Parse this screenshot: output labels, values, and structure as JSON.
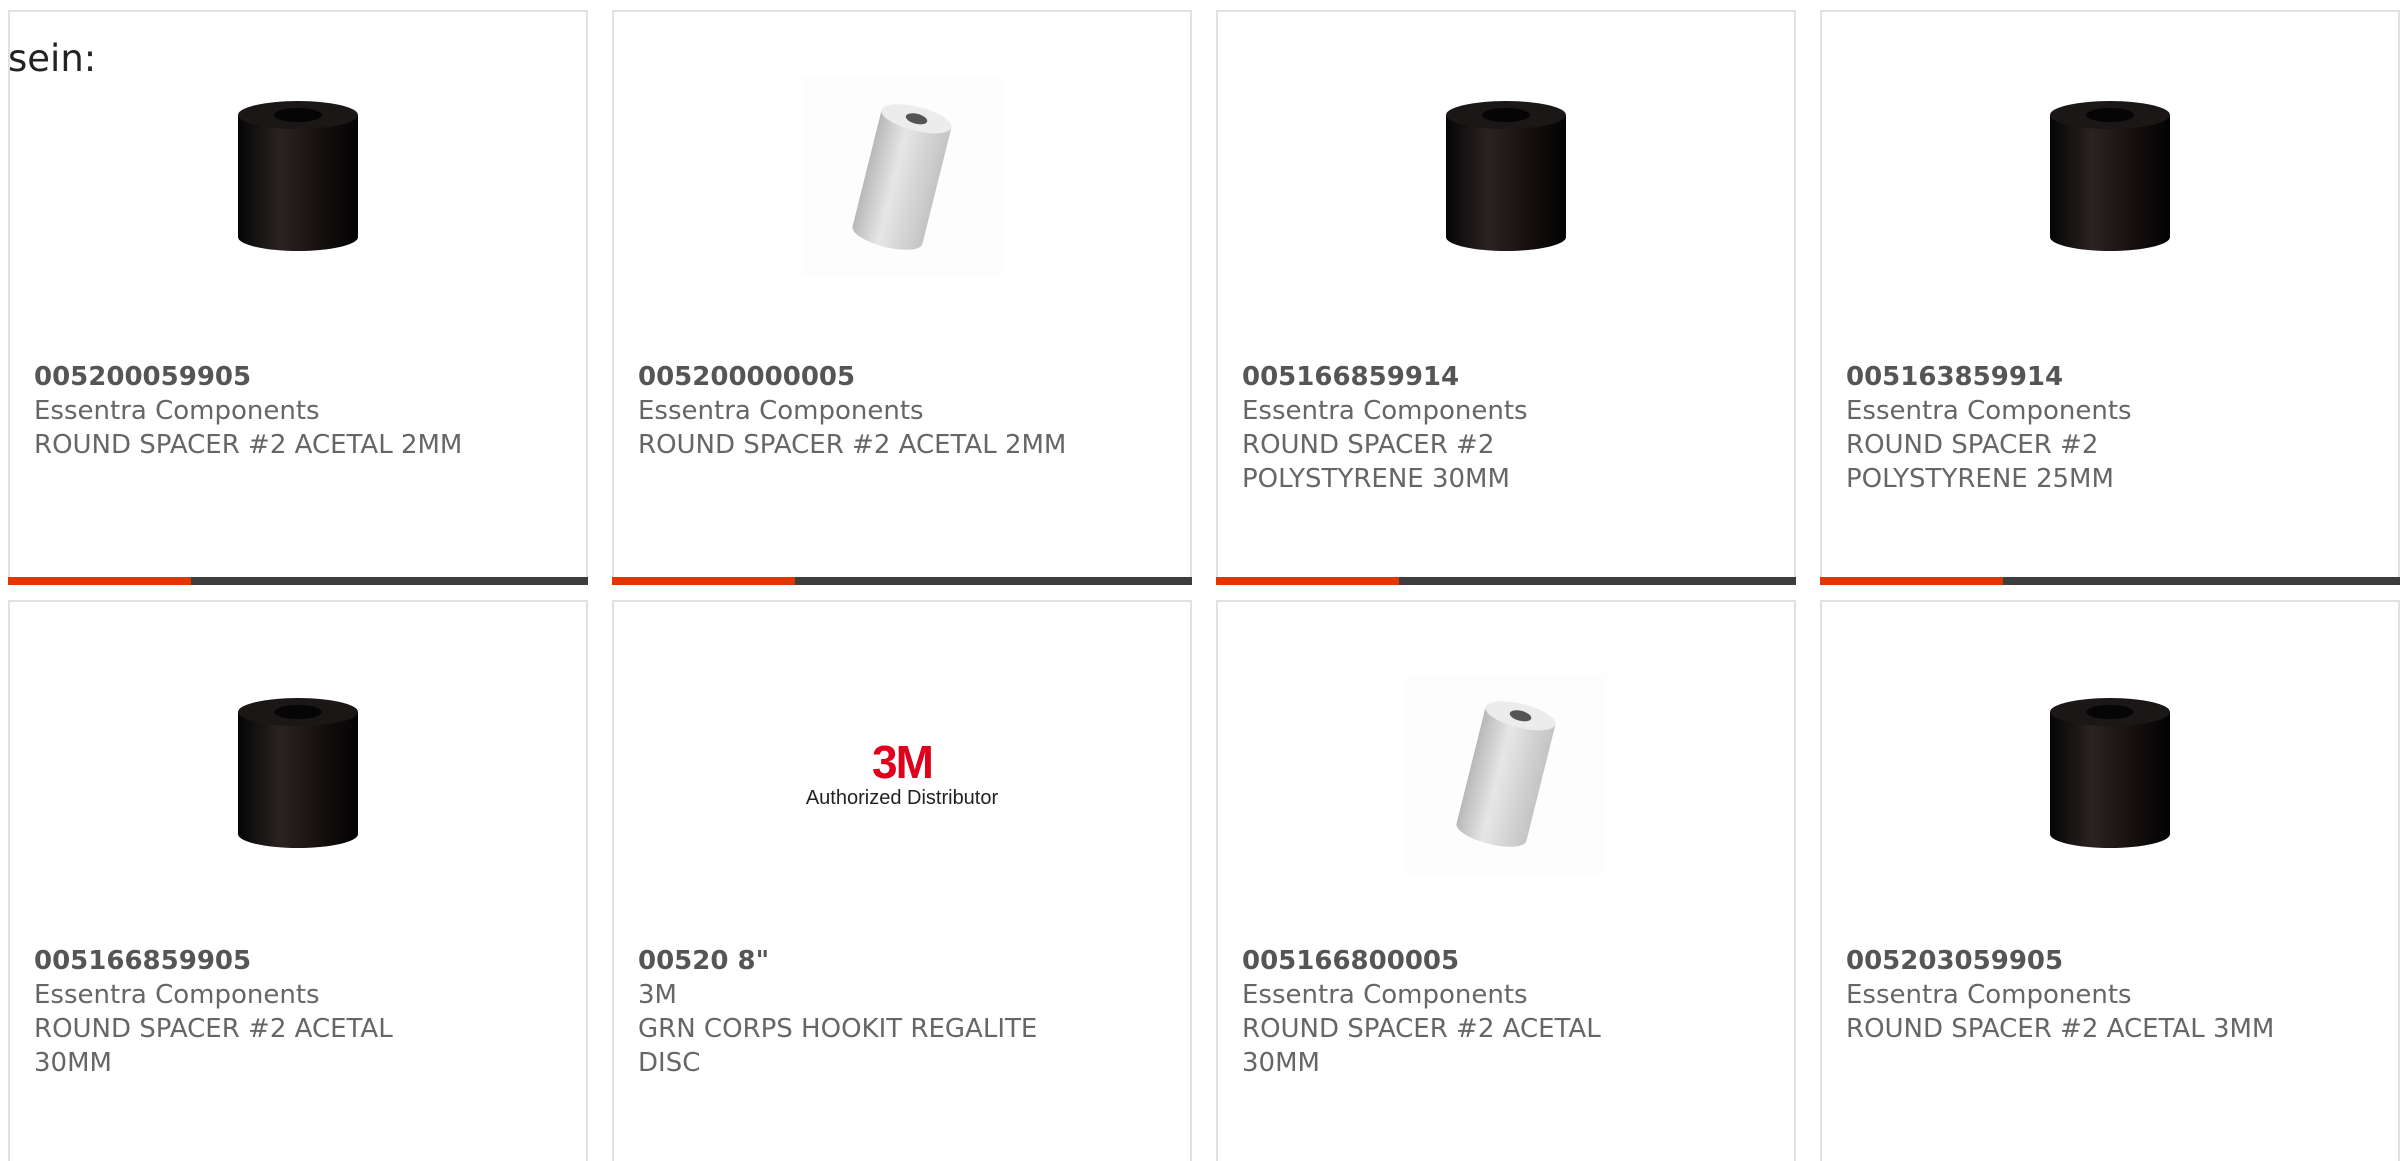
{
  "intro_text": "sein:",
  "colors": {
    "accent": "#e23600",
    "bar": "#3d3d3d",
    "card_border": "#e1e1e1"
  },
  "products": [
    {
      "part_number": "005200059905",
      "manufacturer": "Essentra Components",
      "description": "ROUND SPACER #2 ACETAL 2MM",
      "image": "black-spacer"
    },
    {
      "part_number": "005200000005",
      "manufacturer": "Essentra Components",
      "description": "ROUND SPACER #2 ACETAL 2MM",
      "image": "white-spacer"
    },
    {
      "part_number": "005166859914",
      "manufacturer": "Essentra Components",
      "description": "ROUND SPACER #2 POLYSTYRENE 30MM",
      "image": "black-spacer"
    },
    {
      "part_number": "005163859914",
      "manufacturer": "Essentra Components",
      "description": "ROUND SPACER #2 POLYSTYRENE 25MM",
      "image": "black-spacer"
    },
    {
      "part_number": "005166859905",
      "manufacturer": "Essentra Components",
      "description": "ROUND SPACER #2 ACETAL 30MM",
      "image": "black-spacer"
    },
    {
      "part_number": "00520 8\"",
      "manufacturer": "3M",
      "description": "GRN CORPS HOOKIT REGALITE DISC",
      "image": "3m-logo",
      "logo_mark": "3M",
      "logo_sub": "Authorized Distributor"
    },
    {
      "part_number": "005166800005",
      "manufacturer": "Essentra Components",
      "description": "ROUND SPACER #2 ACETAL 30MM",
      "image": "white-spacer"
    },
    {
      "part_number": "005203059905",
      "manufacturer": "Essentra Components",
      "description": "ROUND SPACER #2 ACETAL 3MM",
      "image": "black-spacer"
    }
  ]
}
